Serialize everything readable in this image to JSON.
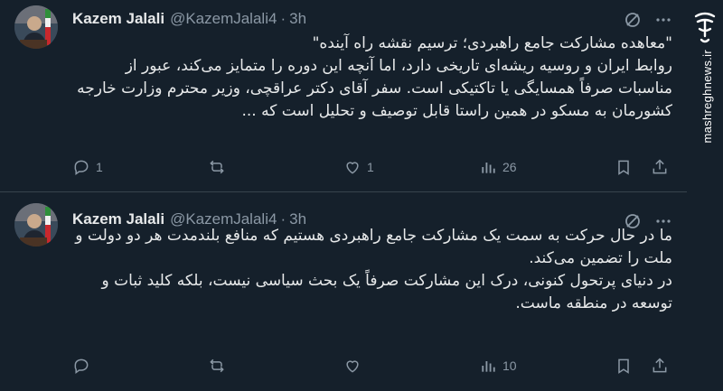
{
  "tweets": [
    {
      "author_name": "Kazem Jalali",
      "handle": "@KazemJalali4",
      "separator": "·",
      "time": "3h",
      "lines": [
        "\"معاهده مشارکت جامع راهبردی؛ ترسیم نقشه راه آینده\"",
        "روابط ایران و روسیه ریشه‌ای تاریخی دارد، اما آنچه این دوره را متمایز می‌کند، عبور از مناسبات صرفاً همسایگی یا تاکتیکی است. سفر آقای دکتر عراقچی، وزیر محترم وزارت خارجه کشورمان به مسکو در همین راستا قابل توصیف و تحلیل است که ..."
      ],
      "actions": {
        "reply_count": "1",
        "repost_count": "",
        "like_count": "1",
        "view_count": "26"
      }
    },
    {
      "author_name": "Kazem Jalali",
      "handle": "@KazemJalali4",
      "separator": "·",
      "time": "3h",
      "lines": [
        "ما در حال حرکت به سمت یک مشارکت جامع راهبردی هستیم که منافع بلندمدت هر دو دولت و ملت را تضمین می‌کند.",
        "در دنیای پرتحول کنونی، درک این مشارکت صرفاً یک بحث سیاسی نیست، بلکه کلید ثبات و توسعه در منطقه ماست."
      ],
      "actions": {
        "reply_count": "",
        "repost_count": "",
        "like_count": "",
        "view_count": "10"
      }
    }
  ],
  "watermark": {
    "logo_text": "مشرق",
    "url": "mashreghnews.ir"
  },
  "colors": {
    "background": "#15202b",
    "text_primary": "#e7e9ea",
    "text_secondary": "#8b98a5",
    "divider": "#38444d"
  }
}
